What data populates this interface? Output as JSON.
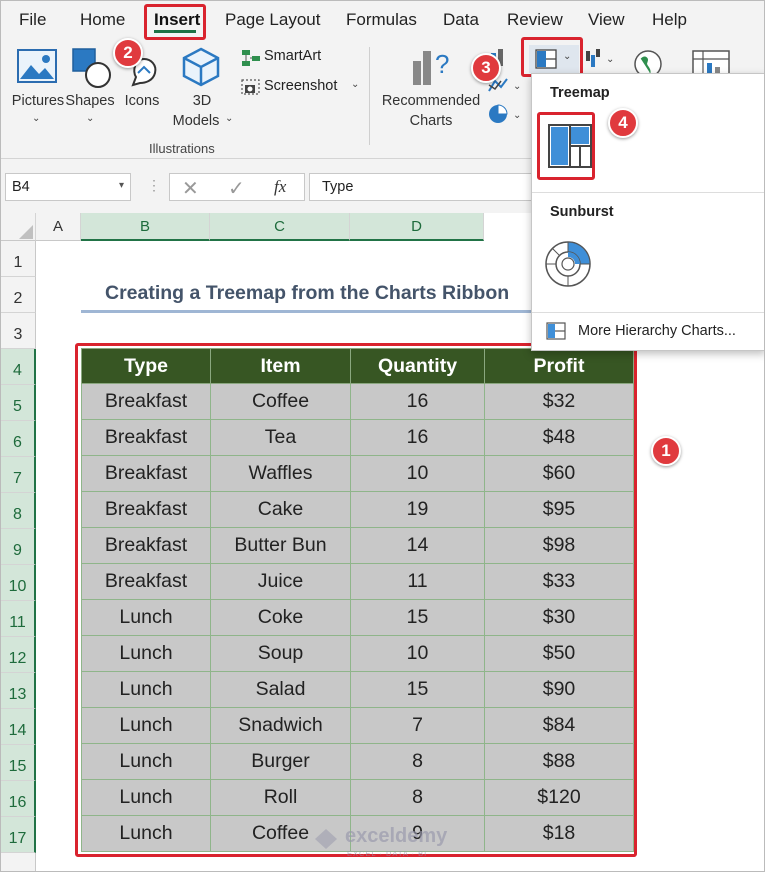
{
  "menu": {
    "tabs": [
      {
        "label": "File"
      },
      {
        "label": "Home"
      },
      {
        "label": "Insert"
      },
      {
        "label": "Page Layout"
      },
      {
        "label": "Formulas"
      },
      {
        "label": "Data"
      },
      {
        "label": "Review"
      },
      {
        "label": "View"
      },
      {
        "label": "Help"
      }
    ]
  },
  "ribbon": {
    "pictures": "Pictures",
    "shapes": "Shapes",
    "icons": "Icons",
    "models_line1": "3D",
    "models_line2": "Models",
    "smartart": "SmartArt",
    "screenshot": "Screenshot",
    "recommended_line1": "Recommended",
    "recommended_line2": "Charts",
    "group_caption": "Illustrations"
  },
  "formula_bar": {
    "name_box": "B4",
    "content": "Type"
  },
  "grid": {
    "columns": [
      "A",
      "B",
      "C",
      "D"
    ],
    "rows": [
      "1",
      "2",
      "3",
      "4",
      "5",
      "6",
      "7",
      "8",
      "9",
      "10",
      "11",
      "12",
      "13",
      "14",
      "15",
      "16",
      "17"
    ]
  },
  "sheet": {
    "title": "Creating a Treemap from the Charts Ribbon",
    "headers": [
      "Type",
      "Item",
      "Quantity",
      "Profit"
    ],
    "rows": [
      [
        "Breakfast",
        "Coffee",
        "16",
        "$32"
      ],
      [
        "Breakfast",
        "Tea",
        "16",
        "$48"
      ],
      [
        "Breakfast",
        "Waffles",
        "10",
        "$60"
      ],
      [
        "Breakfast",
        "Cake",
        "19",
        "$95"
      ],
      [
        "Breakfast",
        "Butter Bun",
        "14",
        "$98"
      ],
      [
        "Breakfast",
        "Juice",
        "11",
        "$33"
      ],
      [
        "Lunch",
        "Coke",
        "15",
        "$30"
      ],
      [
        "Lunch",
        "Soup",
        "10",
        "$50"
      ],
      [
        "Lunch",
        "Salad",
        "15",
        "$90"
      ],
      [
        "Lunch",
        "Snadwich",
        "7",
        "$84"
      ],
      [
        "Lunch",
        "Burger",
        "8",
        "$88"
      ],
      [
        "Lunch",
        "Roll",
        "8",
        "$120"
      ],
      [
        "Lunch",
        "Coffee",
        "9",
        "$18"
      ]
    ]
  },
  "dropdown": {
    "treemap_heading": "Treemap",
    "sunburst_heading": "Sunburst",
    "more_label": "More Hierarchy Charts..."
  },
  "badges": [
    "1",
    "2",
    "3",
    "4"
  ],
  "watermark": {
    "name": "exceldemy",
    "tagline": "EXCEL · DATA · BI"
  },
  "colors": {
    "header_green": "#375623",
    "accent_red": "#d9232e",
    "excel_green": "#217346"
  }
}
